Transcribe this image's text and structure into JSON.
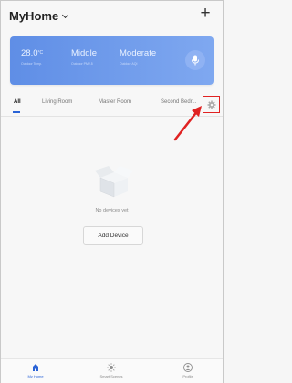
{
  "header": {
    "home_name": "MyHome",
    "add_label": "+"
  },
  "weather": {
    "temperature_value": "28.0",
    "temperature_unit": "°C",
    "temperature_caption": "Outdoor Temp.",
    "pm_value": "Middle",
    "pm_caption": "Outdoor PM2.5",
    "aqi_value": "Moderate",
    "aqi_caption": "Outdoor AQI",
    "mic_icon": "microphone-icon"
  },
  "tabs": {
    "items": [
      "All",
      "Living Room",
      "Master Room",
      "Second Bedr..."
    ],
    "active_index": 0,
    "settings_icon": "gear-icon"
  },
  "empty_state": {
    "message": "No devices yet",
    "add_button": "Add Device"
  },
  "bottom_nav": {
    "items": [
      {
        "label": "My Home",
        "icon": "home-icon",
        "active": true
      },
      {
        "label": "Smart Scenes",
        "icon": "sun-icon",
        "active": false
      },
      {
        "label": "Profile",
        "icon": "user-icon",
        "active": false
      }
    ]
  },
  "colors": {
    "accent": "#2a63d6",
    "card": "#6b97ea",
    "highlight": "#e02222"
  }
}
